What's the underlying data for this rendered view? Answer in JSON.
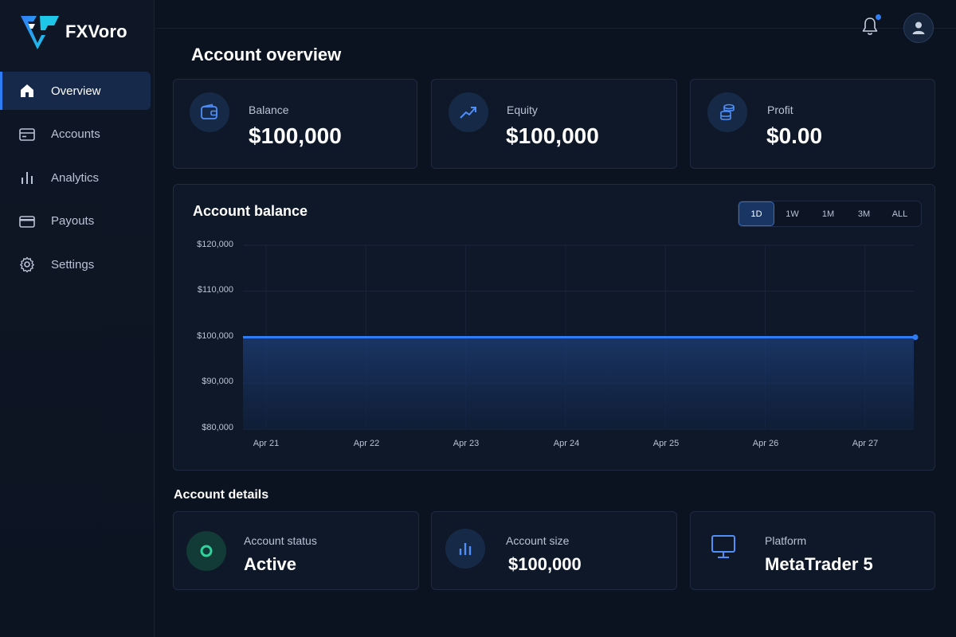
{
  "app": {
    "name": "FXVoro"
  },
  "sidebar": {
    "items": [
      {
        "label": "Overview",
        "icon": "home-icon",
        "active": true
      },
      {
        "label": "Accounts",
        "icon": "card-icon"
      },
      {
        "label": "Analytics",
        "icon": "bar-chart-icon"
      },
      {
        "label": "Payouts",
        "icon": "credit-card-icon"
      },
      {
        "label": "Settings",
        "icon": "gear-icon"
      }
    ]
  },
  "header": {
    "title": "Account overview",
    "notification_icon": "bell-icon",
    "avatar_icon": "user-icon"
  },
  "stats": [
    {
      "label": "Balance",
      "value": "$100,000",
      "icon": "wallet-icon"
    },
    {
      "label": "Equity",
      "value": "$100,000",
      "icon": "trending-up-icon"
    },
    {
      "label": "Profit",
      "value": "$0.00",
      "icon": "coins-icon"
    }
  ],
  "chart": {
    "title": "Account balance",
    "ranges": [
      "1D",
      "1W",
      "1M",
      "3M",
      "ALL"
    ],
    "active_range": "1D"
  },
  "chart_data": {
    "type": "area",
    "title": "Account balance",
    "x": [
      "Apr 21",
      "Apr 22",
      "Apr 23",
      "Apr 24",
      "Apr 25",
      "Apr 26",
      "Apr 27"
    ],
    "y_ticks": [
      "$120,000",
      "$110,000",
      "$100,000",
      "$90,000",
      "$80,000"
    ],
    "ylim": [
      80000,
      120000
    ],
    "series": [
      {
        "values": [
          100000,
          100000,
          100000,
          100000,
          100000,
          100000,
          100000,
          100000
        ]
      }
    ],
    "grid": true,
    "colors": {
      "line": "#2f7df6"
    }
  },
  "details": {
    "title": "Account details",
    "items": [
      {
        "label": "Account status",
        "value": "Active",
        "icon": "status-ring-icon"
      },
      {
        "label": "Account size",
        "value": "$100,000",
        "icon": "bar-chart-icon"
      },
      {
        "label": "Platform",
        "value": "MetaTrader 5",
        "icon": "monitor-icon"
      }
    ]
  },
  "colors": {
    "accent": "#2f7df6",
    "success": "#2fd39b",
    "background": "#0b1220"
  }
}
